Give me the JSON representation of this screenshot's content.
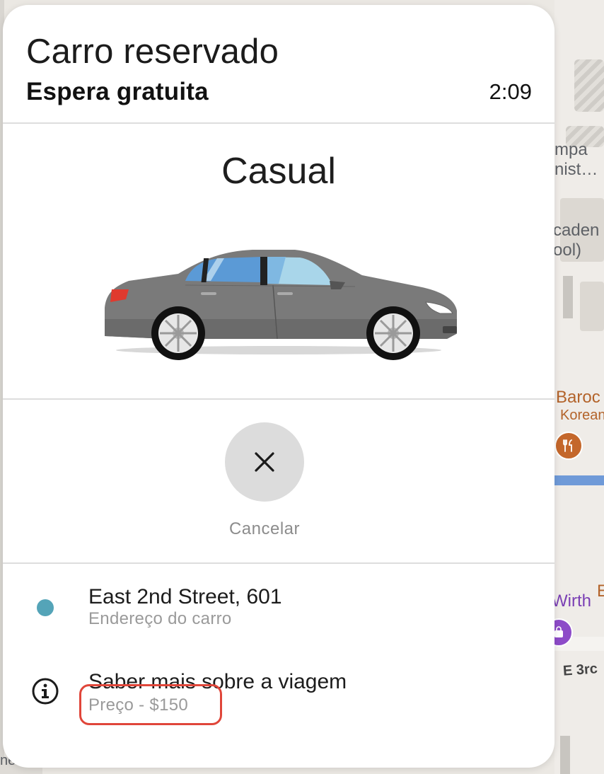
{
  "sheet": {
    "title": "Carro reservado",
    "subtitle": "Espera gratuita",
    "timer": "2:09"
  },
  "ride": {
    "type": "Casual",
    "car_icon": "sedan-car-illustration",
    "car_color": "#7a7a7a"
  },
  "cancel": {
    "icon": "close-icon",
    "label": "Cancelar"
  },
  "pickup": {
    "address": "East 2nd Street, 601",
    "caption": "Endereço do carro",
    "dot_color": "#54a4b8"
  },
  "trip_info": {
    "title": "Saber mais sobre a viagem",
    "price": "Preço - $150",
    "icon": "info-icon"
  },
  "highlight_color": "#e0463a",
  "map": {
    "labels": [
      "mpa",
      "nist…",
      "caden",
      "ool)",
      "Baroc",
      "Korean",
      "Wirth",
      "E",
      "E 3rc",
      "nes"
    ]
  }
}
